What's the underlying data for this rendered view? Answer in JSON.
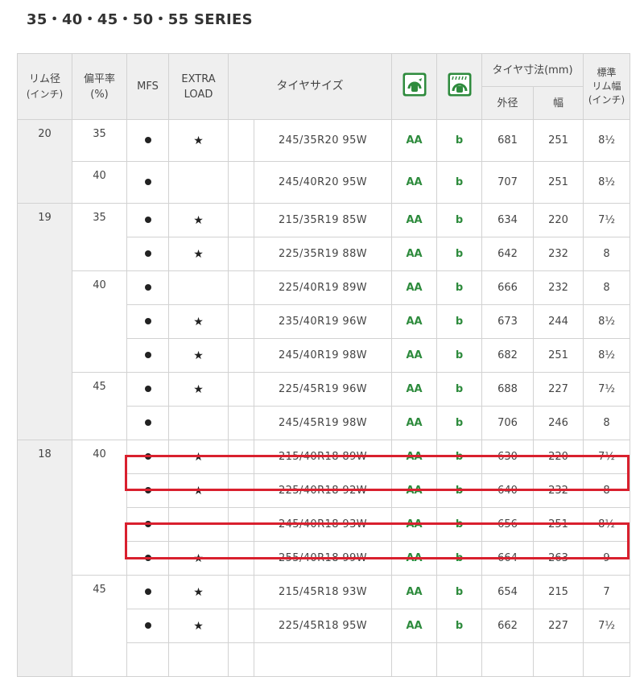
{
  "title": "35・40・45・50・55 SERIES",
  "header": {
    "rim_diameter": "リム径",
    "rim_diameter_unit": "(インチ)",
    "aspect_ratio": "偏平率",
    "aspect_ratio_unit": "(%)",
    "mfs": "MFS",
    "extra_load_line1": "EXTRA",
    "extra_load_line2": "LOAD",
    "tire_size": "タイヤサイズ",
    "rolling_resistance_icon": "rolling-resistance-label-icon",
    "wet_grip_icon": "wet-grip-label-icon",
    "tire_dimensions": "タイヤ寸法(mm)",
    "outer_diameter": "外径",
    "width": "幅",
    "std_rim_width_line1": "標準",
    "std_rim_width_line2": "リム幅",
    "std_rim_width_line3": "(インチ)"
  },
  "colors": {
    "label_green": "#2e8b3d",
    "highlight_red": "#d9202e",
    "header_bg": "#efefef"
  },
  "rim_groups": [
    {
      "rim": "20",
      "rate_groups": [
        {
          "rate": "35",
          "rows": [
            {
              "mfs": "●",
              "xl": "★",
              "size": "245/35R20 95W",
              "rr": "AA",
              "wet": "b",
              "od": "681",
              "w": "251",
              "rim_w": "8½"
            }
          ]
        },
        {
          "rate": "40",
          "rows": [
            {
              "mfs": "●",
              "xl": "",
              "size": "245/40R20 95W",
              "rr": "AA",
              "wet": "b",
              "od": "707",
              "w": "251",
              "rim_w": "8½"
            }
          ]
        }
      ]
    },
    {
      "rim": "19",
      "rate_groups": [
        {
          "rate": "35",
          "rows": [
            {
              "mfs": "●",
              "xl": "★",
              "size": "215/35R19 85W",
              "rr": "AA",
              "wet": "b",
              "od": "634",
              "w": "220",
              "rim_w": "7½"
            },
            {
              "mfs": "●",
              "xl": "★",
              "size": "225/35R19 88W",
              "rr": "AA",
              "wet": "b",
              "od": "642",
              "w": "232",
              "rim_w": "8"
            }
          ]
        },
        {
          "rate": "40",
          "rows": [
            {
              "mfs": "●",
              "xl": "",
              "size": "225/40R19 89W",
              "rr": "AA",
              "wet": "b",
              "od": "666",
              "w": "232",
              "rim_w": "8"
            },
            {
              "mfs": "●",
              "xl": "★",
              "size": "235/40R19 96W",
              "rr": "AA",
              "wet": "b",
              "od": "673",
              "w": "244",
              "rim_w": "8½"
            },
            {
              "mfs": "●",
              "xl": "★",
              "size": "245/40R19 98W",
              "rr": "AA",
              "wet": "b",
              "od": "682",
              "w": "251",
              "rim_w": "8½"
            }
          ]
        },
        {
          "rate": "45",
          "rows": [
            {
              "mfs": "●",
              "xl": "★",
              "size": "225/45R19 96W",
              "rr": "AA",
              "wet": "b",
              "od": "688",
              "w": "227",
              "rim_w": "7½"
            },
            {
              "mfs": "●",
              "xl": "",
              "size": "245/45R19 98W",
              "rr": "AA",
              "wet": "b",
              "od": "706",
              "w": "246",
              "rim_w": "8"
            }
          ]
        }
      ]
    },
    {
      "rim": "18",
      "rate_groups": [
        {
          "rate": "40",
          "rows": [
            {
              "mfs": "●",
              "xl": "★",
              "size": "215/40R18 89W",
              "rr": "AA",
              "wet": "b",
              "od": "630",
              "w": "220",
              "rim_w": "7½"
            },
            {
              "mfs": "●",
              "xl": "★",
              "size": "225/40R18 92W",
              "rr": "AA",
              "wet": "b",
              "od": "640",
              "w": "232",
              "rim_w": "8",
              "highlighted": true
            },
            {
              "mfs": "●",
              "xl": "",
              "size": "245/40R18 93W",
              "rr": "AA",
              "wet": "b",
              "od": "656",
              "w": "251",
              "rim_w": "8½"
            },
            {
              "mfs": "●",
              "xl": "★",
              "size": "255/40R18 99W",
              "rr": "AA",
              "wet": "b",
              "od": "664",
              "w": "263",
              "rim_w": "9",
              "highlighted": true
            }
          ]
        },
        {
          "rate": "45",
          "rows": [
            {
              "mfs": "●",
              "xl": "★",
              "size": "215/45R18 93W",
              "rr": "AA",
              "wet": "b",
              "od": "654",
              "w": "215",
              "rim_w": "7"
            },
            {
              "mfs": "●",
              "xl": "★",
              "size": "225/45R18 95W",
              "rr": "AA",
              "wet": "b",
              "od": "662",
              "w": "227",
              "rim_w": "7½"
            },
            {
              "mfs": "",
              "xl": "",
              "size": "",
              "rr": "",
              "wet": "",
              "od": "",
              "w": "",
              "rim_w": ""
            }
          ]
        }
      ]
    }
  ]
}
